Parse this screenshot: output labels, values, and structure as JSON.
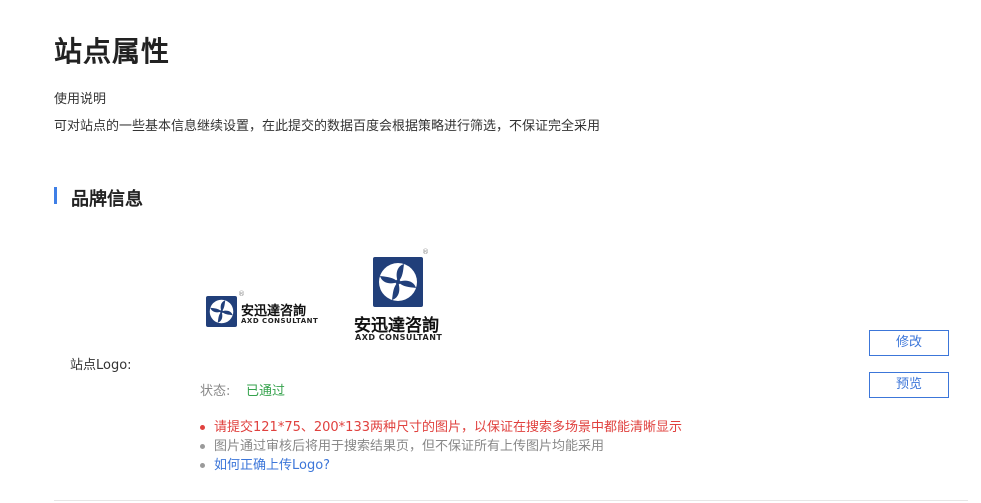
{
  "page": {
    "title": "站点属性",
    "usage_title": "使用说明",
    "usage_desc": "可对站点的一些基本信息继续设置，在此提交的数据百度会根据策略进行筛选，不保证完全采用"
  },
  "brand_section": {
    "title": "品牌信息",
    "logo_label": "站点Logo:",
    "logo": {
      "cn_name": "安迅達咨詢",
      "en_name": "AXD CONSULTANT",
      "reg_mark": "®",
      "mark_color": "#213f7a"
    },
    "status_label": "状态:",
    "status_value": "已通过",
    "status_color": "#35a24c",
    "edit_button": "修改",
    "preview_button": "预览",
    "tips": [
      "请提交121*75、200*133两种尺寸的图片，以保证在搜索多场景中都能清晰显示",
      "图片通过审核后将用于搜索结果页，但不保证所有上传图片均能采用",
      "如何正确上传Logo?"
    ]
  },
  "colors": {
    "accent": "#3c76d9",
    "warning": "#e0413e",
    "muted": "#888888"
  }
}
